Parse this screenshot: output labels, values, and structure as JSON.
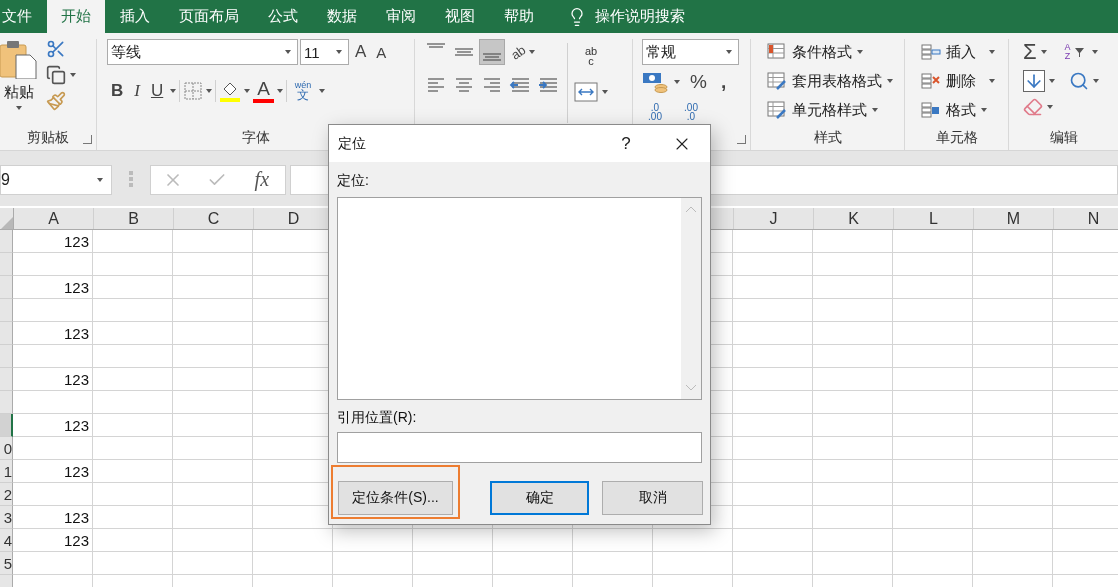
{
  "tabs": [
    {
      "label": "文件",
      "selected": false
    },
    {
      "label": "开始",
      "selected": true
    },
    {
      "label": "插入",
      "selected": false
    },
    {
      "label": "页面布局",
      "selected": false
    },
    {
      "label": "公式",
      "selected": false
    },
    {
      "label": "数据",
      "selected": false
    },
    {
      "label": "审阅",
      "selected": false
    },
    {
      "label": "视图",
      "selected": false
    },
    {
      "label": "帮助",
      "selected": false
    }
  ],
  "tell_me": {
    "label": "操作说明搜索"
  },
  "ribbon": {
    "clipboard": {
      "paste_label": "粘贴",
      "label": "剪贴板"
    },
    "font": {
      "label": "字体",
      "font_name": "等线",
      "font_size": "11",
      "grow_label": "A",
      "shrink_label": "A",
      "styles": [
        "B",
        "I",
        "U"
      ],
      "font_color_label": "A",
      "phonetic_top": "wén",
      "phonetic_bottom": "文"
    },
    "alignment": {
      "vertical": [
        {
          "selected": false
        },
        {
          "selected": false
        },
        {
          "selected": true
        }
      ],
      "orientation_label": "ab",
      "wrap_top": "ab",
      "wrap_bottom": "c"
    },
    "number": {
      "format": "常规",
      "percent": "%",
      "comma": ",",
      "increase_top": ".0",
      "increase_bottom": ".00",
      "decrease_top": ".00",
      "decrease_bottom": ".0"
    },
    "styles": {
      "label": "样式",
      "items": [
        "条件格式",
        "套用表格格式",
        "单元格样式"
      ]
    },
    "cells": {
      "label": "单元格",
      "items": [
        "插入",
        "删除",
        "格式"
      ]
    },
    "editing": {
      "label": "编辑",
      "sum": "Σ",
      "sort_top": "A",
      "sort_bottom": "Z"
    }
  },
  "formula_bar": {
    "name_box": "9",
    "function_label": "fx"
  },
  "sheet": {
    "columns": [
      "A",
      "B",
      "C",
      "D",
      "J",
      "K",
      "L",
      "M",
      "N"
    ],
    "rows": [
      {
        "value": "123",
        "selected": false
      },
      {
        "selected": false
      },
      {
        "value": "123",
        "selected": false
      },
      {
        "selected": false
      },
      {
        "value": "123",
        "selected": false
      },
      {
        "selected": false
      },
      {
        "value": "123",
        "selected": false
      },
      {
        "selected": false
      },
      {
        "value": "123",
        "selected": true
      },
      {
        "label": "0",
        "selected": false
      },
      {
        "label": "1",
        "value": "123",
        "selected": false
      },
      {
        "label": "2",
        "selected": false
      },
      {
        "label": "3",
        "value": "123",
        "selected": false
      },
      {
        "label": "4",
        "value": "123",
        "selected": false
      },
      {
        "label": "5",
        "selected": false
      },
      {
        "selected": false
      }
    ]
  },
  "dialog": {
    "title": "定位",
    "help": "?",
    "list_label": "定位:",
    "reference_label": "引用位置(R):",
    "buttons": [
      {
        "label": "定位条件(S)...",
        "highlighted": true,
        "default": false
      },
      {
        "label": "确定",
        "highlighted": false,
        "default": true
      },
      {
        "label": "取消",
        "highlighted": false,
        "default": false
      }
    ]
  }
}
